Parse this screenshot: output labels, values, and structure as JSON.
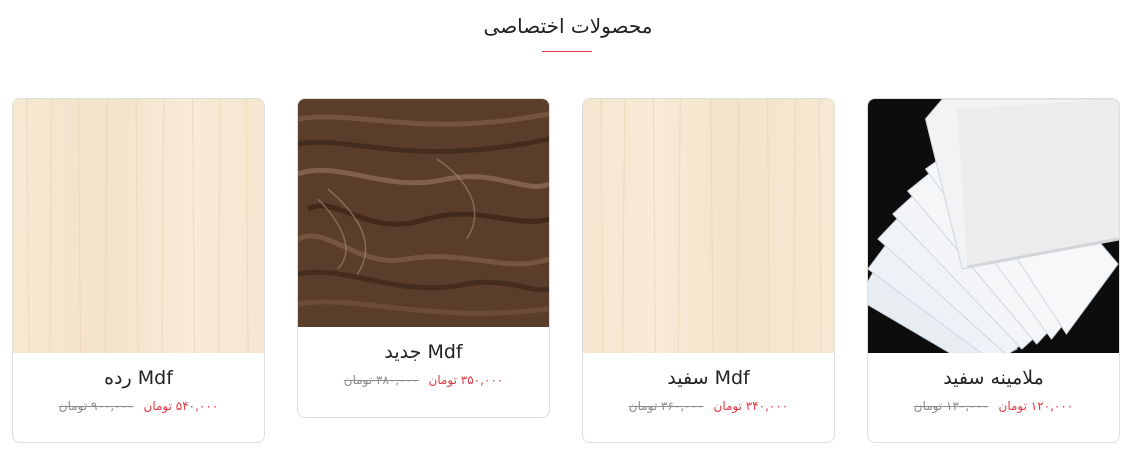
{
  "section": {
    "title": "محصولات اختصاصی",
    "accent_color": "#d9343f"
  },
  "products": [
    {
      "name": "ملامینه سفید",
      "price": "۱۲۰,۰۰۰ تومان",
      "old_price": "۱۳۰,۰۰۰ تومان",
      "image": "white-sheets"
    },
    {
      "name": "Mdf سفید",
      "price": "۳۴۰,۰۰۰ تومان",
      "old_price": "۳۶۰,۰۰۰ تومان",
      "image": "light-wood"
    },
    {
      "name": "Mdf جدید",
      "price": "۳۵۰,۰۰۰ تومان",
      "old_price": "۳۸۰,۰۰۰ تومان",
      "image": "dark-wood"
    },
    {
      "name": "Mdf رده",
      "price": "۵۴۰,۰۰۰ تومان",
      "old_price": "۹۰۰,۰۰۰ تومان",
      "image": "light-wood"
    }
  ]
}
